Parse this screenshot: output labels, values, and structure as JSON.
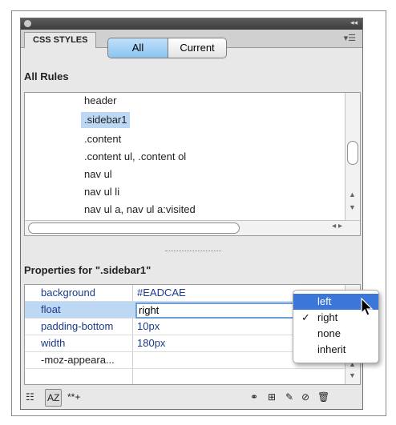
{
  "panel": {
    "tab_label": "CSS STYLES",
    "collapse_icon": "double-arrow-icon",
    "menu_icon": "panel-menu-icon"
  },
  "mode_toggle": {
    "all_label": "All",
    "current_label": "Current",
    "selected": "All"
  },
  "all_rules": {
    "heading": "All Rules",
    "items": [
      {
        "label": "header",
        "selected": false
      },
      {
        "label": ".sidebar1",
        "selected": true
      },
      {
        "label": ".content",
        "selected": false
      },
      {
        "label": ".content ul, .content ol",
        "selected": false
      },
      {
        "label": "nav ul",
        "selected": false
      },
      {
        "label": "nav ul li",
        "selected": false
      },
      {
        "label": "nav ul a, nav ul a:visited",
        "selected": false
      }
    ]
  },
  "properties": {
    "heading": "Properties for \".sidebar1\"",
    "rows": [
      {
        "name": "background",
        "value": "#EADCAE"
      },
      {
        "name": "float",
        "value": "right"
      },
      {
        "name": "padding-bottom",
        "value": "10px"
      },
      {
        "name": "width",
        "value": "180px"
      },
      {
        "name": "-moz-appeara...",
        "value": ""
      }
    ]
  },
  "dropdown": {
    "options": [
      "left",
      "right",
      "none",
      "inherit"
    ],
    "highlighted": "left",
    "checked": "right"
  },
  "toolbar": {
    "show_category_icon": "category-view-icon",
    "sort_az_label": "AZ",
    "show_set_label": "**+"
  },
  "colors": {
    "selection": "#bcd8f4",
    "highlight": "#3a77d8",
    "property_text": "#1c3a8a"
  }
}
